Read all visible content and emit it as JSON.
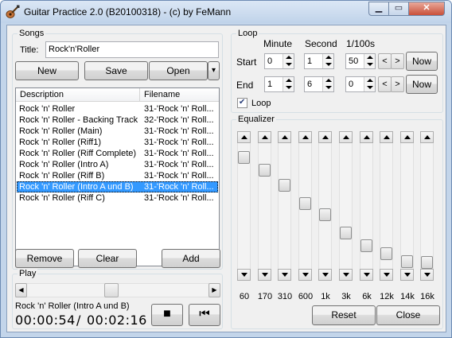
{
  "window": {
    "title": "Guitar Practice 2.0 (B20100318) - (c) by FeMann",
    "min_label": "▁",
    "max_label": "▭",
    "close_label": "✕"
  },
  "songs": {
    "legend": "Songs",
    "title_label": "Title:",
    "title_value": "Rock'n'Roller",
    "new_label": "New",
    "save_label": "Save",
    "open_label": "Open",
    "open_menu_arrow": "▾",
    "columns": [
      "Description",
      "Filename"
    ],
    "rows": [
      {
        "desc": "Rock 'n' Roller",
        "file": "31-'Rock 'n' Roll...",
        "selected": false
      },
      {
        "desc": "Rock 'n' Roller - Backing Track",
        "file": "32-'Rock 'n' Roll...",
        "selected": false
      },
      {
        "desc": "Rock 'n' Roller (Main)",
        "file": "31-'Rock 'n' Roll...",
        "selected": false
      },
      {
        "desc": "Rock 'n' Roller (Riff1)",
        "file": "31-'Rock 'n' Roll...",
        "selected": false
      },
      {
        "desc": "Rock 'n' Roller (Riff Complete)",
        "file": "31-'Rock 'n' Roll...",
        "selected": false
      },
      {
        "desc": "Rock 'n' Roller (Intro A)",
        "file": "31-'Rock 'n' Roll...",
        "selected": false
      },
      {
        "desc": "Rock 'n' Roller (Riff B)",
        "file": "31-'Rock 'n' Roll...",
        "selected": false
      },
      {
        "desc": "Rock 'n' Roller (Intro A und B)",
        "file": "31-'Rock 'n' Roll...",
        "selected": true
      },
      {
        "desc": "Rock 'n' Roller (Riff C)",
        "file": "31-'Rock 'n' Roll...",
        "selected": false
      }
    ],
    "remove_label": "Remove",
    "clear_label": "Clear",
    "add_label": "Add"
  },
  "play": {
    "legend": "Play",
    "now_playing": "Rock 'n' Roller (Intro A und B)",
    "position_fraction": 0.46,
    "time_current": "00:00:54",
    "time_sep": "/",
    "time_total": "00:02:16",
    "stop_icon": "■",
    "rewind_icon": "⏮"
  },
  "loop": {
    "legend": "Loop",
    "col_minute": "Minute",
    "col_second": "Second",
    "col_hundredths": "1/100s",
    "start_label": "Start",
    "end_label": "End",
    "start": {
      "minute": "0",
      "second": "1",
      "hundredths": "50"
    },
    "end": {
      "minute": "1",
      "second": "6",
      "hundredths": "0"
    },
    "prev_label": "<",
    "next_label": ">",
    "now_label": "Now",
    "loop_label": "Loop",
    "loop_checked": true,
    "check_mark": "✔"
  },
  "equalizer": {
    "legend": "Equalizer",
    "bands": [
      {
        "label": "60",
        "level": 0.07
      },
      {
        "label": "170",
        "level": 0.18
      },
      {
        "label": "310",
        "level": 0.32
      },
      {
        "label": "600",
        "level": 0.48
      },
      {
        "label": "1k",
        "level": 0.58
      },
      {
        "label": "3k",
        "level": 0.74
      },
      {
        "label": "6k",
        "level": 0.85
      },
      {
        "label": "12k",
        "level": 0.92
      },
      {
        "label": "14k",
        "level": 0.99
      },
      {
        "label": "16k",
        "level": 1.0
      }
    ],
    "reset_label": "Reset",
    "close_label": "Close"
  }
}
